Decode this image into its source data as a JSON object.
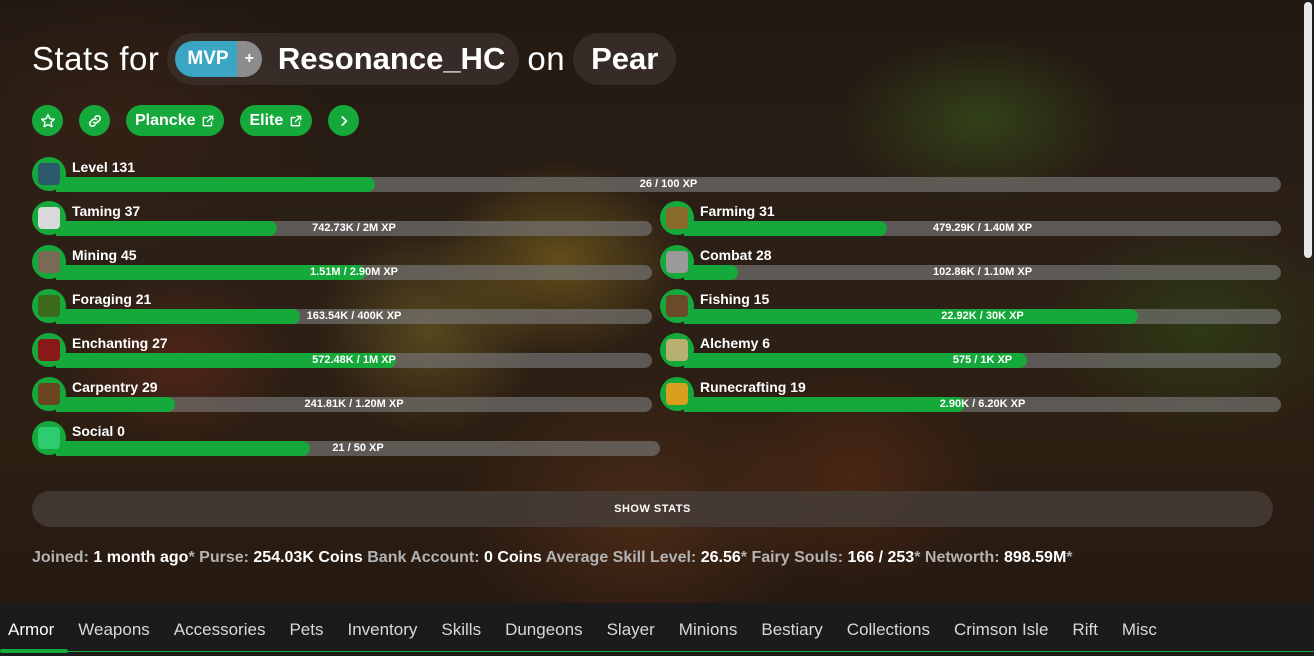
{
  "header": {
    "prefix": "Stats for",
    "rank_main": "MVP",
    "rank_plus": "+",
    "player_name": "Resonance_HC",
    "on_word": "on",
    "profile_name": "Pear"
  },
  "actions": {
    "plancke_label": "Plancke",
    "elite_label": "Elite"
  },
  "skills": {
    "level": {
      "label": "Level 131",
      "xp": "26 / 100 XP",
      "progress": 0.26,
      "icon_color": "#2d5a6b"
    },
    "taming": {
      "label": "Taming 37",
      "xp": "742.73K / 2M XP",
      "progress": 0.37,
      "icon_color": "#d9d9d9"
    },
    "farming": {
      "label": "Farming 31",
      "xp": "479.29K / 1.40M XP",
      "progress": 0.34,
      "icon_color": "#8a6a2a"
    },
    "mining": {
      "label": "Mining 45",
      "xp": "1.51M / 2.90M XP",
      "progress": 0.52,
      "icon_color": "#7a6a55"
    },
    "combat": {
      "label": "Combat 28",
      "xp": "102.86K / 1.10M XP",
      "progress": 0.09,
      "icon_color": "#9a9a9a"
    },
    "foraging": {
      "label": "Foraging 21",
      "xp": "163.54K / 400K XP",
      "progress": 0.41,
      "icon_color": "#3a6a1a"
    },
    "fishing": {
      "label": "Fishing 15",
      "xp": "22.92K / 30K XP",
      "progress": 0.76,
      "icon_color": "#6b4a2a"
    },
    "enchanting": {
      "label": "Enchanting 27",
      "xp": "572.48K / 1M XP",
      "progress": 0.57,
      "icon_color": "#8a1a1a"
    },
    "alchemy": {
      "label": "Alchemy 6",
      "xp": "575 / 1K XP",
      "progress": 0.575,
      "icon_color": "#b8b070"
    },
    "carpentry": {
      "label": "Carpentry 29",
      "xp": "241.81K / 1.20M XP",
      "progress": 0.2,
      "icon_color": "#6b4520"
    },
    "runecrafting": {
      "label": "Runecrafting 19",
      "xp": "2.90K / 6.20K XP",
      "progress": 0.47,
      "icon_color": "#d9a020"
    },
    "social": {
      "label": "Social 0",
      "xp": "21 / 50 XP",
      "progress": 0.42,
      "icon_color": "#2ecc71"
    }
  },
  "show_stats_label": "SHOW STATS",
  "summary": {
    "joined_k": "Joined:",
    "joined_v": "1 month ago",
    "purse_k": "Purse:",
    "purse_v": "254.03K Coins",
    "bank_k": "Bank Account:",
    "bank_v": "0 Coins",
    "avg_k": "Average Skill Level:",
    "avg_v": "26.56",
    "fairy_k": "Fairy Souls:",
    "fairy_v": "166 / 253",
    "networth_k": "Networth:",
    "networth_v": "898.59M",
    "asterisk": "*"
  },
  "tabs": [
    "Armor",
    "Weapons",
    "Accessories",
    "Pets",
    "Inventory",
    "Skills",
    "Dungeons",
    "Slayer",
    "Minions",
    "Bestiary",
    "Collections",
    "Crimson Isle",
    "Rift",
    "Misc"
  ],
  "colors": {
    "accent": "#15a83b",
    "mvp": "#3aa6c4"
  }
}
